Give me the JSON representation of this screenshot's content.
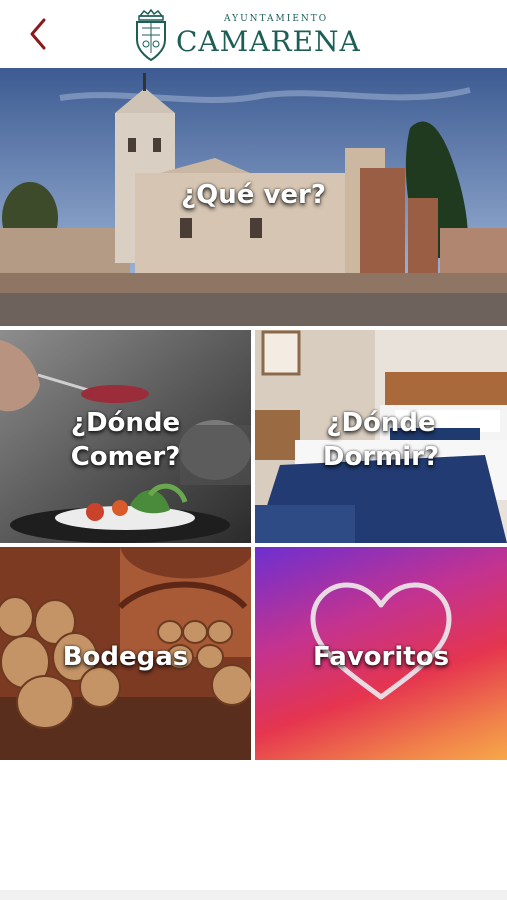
{
  "header": {
    "logo_small": "AYUNTAMIENTO",
    "logo_big": "CAMARENA"
  },
  "tiles": {
    "que_ver": "¿Qué ver?",
    "donde_comer_1": "¿Dónde",
    "donde_comer_2": "Comer?",
    "donde_dormir_1": "¿Dónde",
    "donde_dormir_2": "Dormir?",
    "bodegas": "Bodegas",
    "favoritos": "Favoritos"
  },
  "colors": {
    "brand": "#1d5f57",
    "back_arrow": "#8a1a1a"
  }
}
